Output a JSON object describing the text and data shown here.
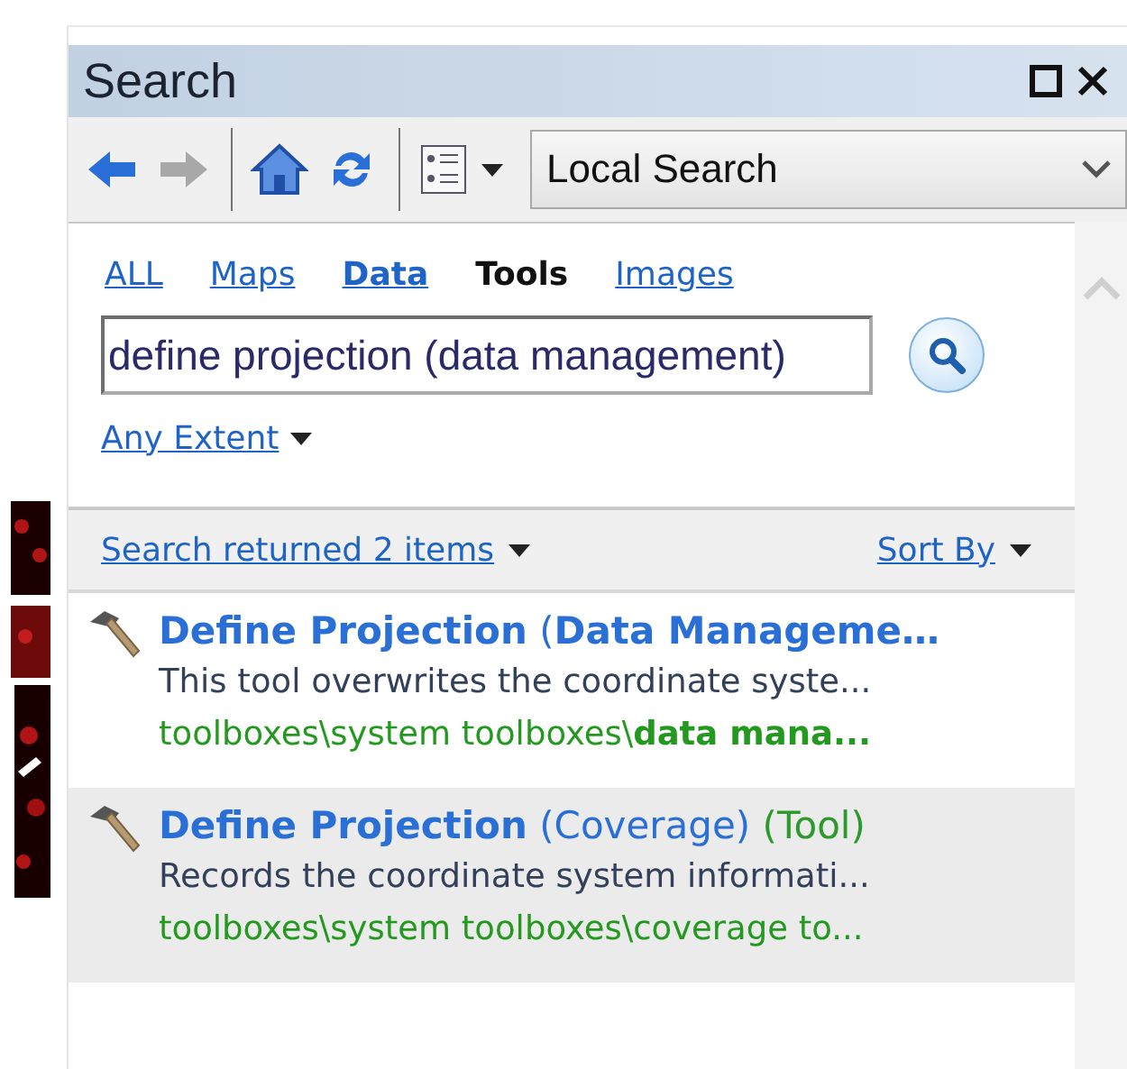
{
  "window": {
    "title": "Search"
  },
  "toolbar": {
    "buttons": [
      {
        "kind": "back",
        "disabled": false
      },
      {
        "kind": "forward",
        "disabled": true
      },
      {
        "kind": "home",
        "disabled": false
      },
      {
        "kind": "refresh",
        "disabled": false
      }
    ],
    "scope": {
      "value": "Local Search"
    }
  },
  "tabs": [
    {
      "label": "ALL",
      "selected": false,
      "bold": false
    },
    {
      "label": "Maps",
      "selected": false,
      "bold": false
    },
    {
      "label": "Data",
      "selected": false,
      "bold": true
    },
    {
      "label": "Tools",
      "selected": true,
      "bold": true
    },
    {
      "label": "Images",
      "selected": false,
      "bold": false
    }
  ],
  "search": {
    "value": "define projection (data management)"
  },
  "extent": {
    "label": "Any Extent"
  },
  "results_header": {
    "summary": "Search returned 2 items",
    "sort": "Sort By"
  },
  "results": [
    {
      "title": "**Define Projection** (**Data Manageme…**",
      "description": "This tool overwrites the coordinate syste...",
      "path": "toolboxes\\system toolboxes\\**data mana...**",
      "selected": false
    },
    {
      "title": "**Define Projection** (Coverage)",
      "type": "(Tool)",
      "description": "Records the coordinate system informati...",
      "path": "toolboxes\\system toolboxes\\coverage to...",
      "selected": true
    }
  ]
}
